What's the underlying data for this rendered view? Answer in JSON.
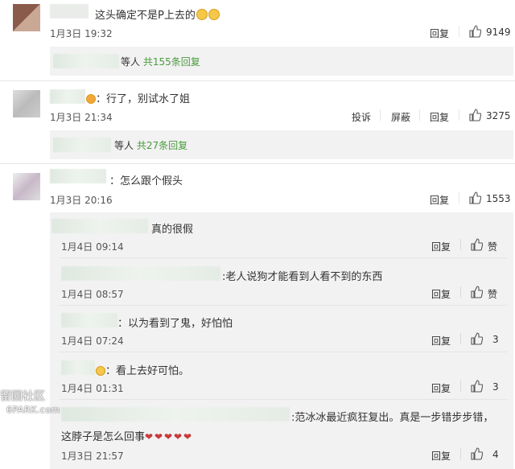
{
  "comments": [
    {
      "text": "这头确定不是P上去的",
      "date": "1月3日 19:32",
      "actions": [
        "回复"
      ],
      "likes": "9149",
      "reply_summary": {
        "suffix": "等人",
        "link": "共155条回复"
      }
    },
    {
      "text": "：行了，别试水了姐",
      "date": "1月3日 21:34",
      "actions": [
        "投诉",
        "屏蔽",
        "回复"
      ],
      "likes": "3275",
      "reply_summary": {
        "suffix": "等人",
        "link": "共27条回复"
      }
    },
    {
      "text": "：怎么跟个假头",
      "date": "1月3日 20:16",
      "actions": [
        "回复"
      ],
      "likes": "1553",
      "replies": [
        {
          "text": "真的很假",
          "date": "1月4日 09:14",
          "reply": "回复",
          "likes": "赞"
        },
        {
          "text": ":老人说狗才能看到人看不到的东西",
          "date": "1月4日 08:57",
          "reply": "回复",
          "likes": "赞"
        },
        {
          "text": "：以为看到了鬼，好怕怕",
          "date": "1月4日 07:24",
          "reply": "回复",
          "likes": "3"
        },
        {
          "text": "：看上去好可怕。",
          "date": "1月4日 01:31",
          "reply": "回复",
          "likes": "3"
        },
        {
          "text": ":范冰冰最近疯狂复出。真是一步错步步错，",
          "text2": "这脖子是怎么回事",
          "date": "1月3日 21:57",
          "reply": "回复",
          "likes": "4"
        }
      ]
    }
  ],
  "watermark": {
    "line1": "留园社区",
    "line2": "6PARK.com"
  },
  "colors": {
    "link_green": "#4a9a3e",
    "sub_bg": "#f2f2f2"
  }
}
